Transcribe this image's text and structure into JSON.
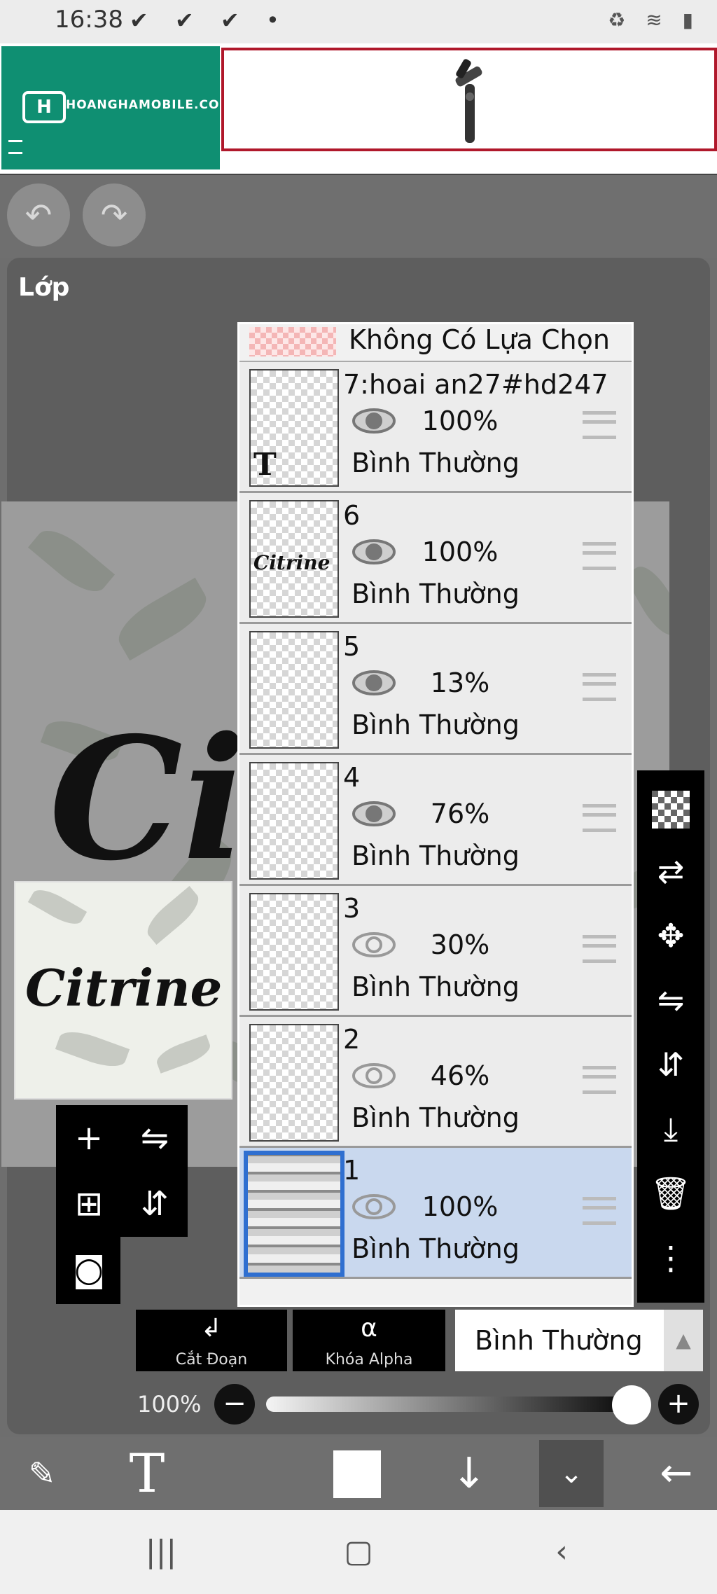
{
  "status_bar": {
    "time": "16:38",
    "notifications": "✔ ✔ ✔ •",
    "system_icons": "♻ ≋ ▮"
  },
  "ad": {
    "brand": "HOANGHAMOBILE.COM",
    "logo_glyph": "H",
    "image_icon": "gimbal-image"
  },
  "panel": {
    "title": "Lớp"
  },
  "canvas": {
    "thumbnail_word": "Citrine",
    "preview_text": "Cit"
  },
  "layers_header": {
    "label": "Không Có Lựa Chọn"
  },
  "layers": [
    {
      "name": "7:hoai an27#hd247",
      "opacity": "100%",
      "mode": "Bình Thường",
      "visible": true,
      "thumb_glyph": "T",
      "selected": false
    },
    {
      "name": "6",
      "opacity": "100%",
      "mode": "Bình Thường",
      "visible": true,
      "thumb_glyph": "Citrine",
      "selected": false
    },
    {
      "name": "5",
      "opacity": "13%",
      "mode": "Bình Thường",
      "visible": true,
      "thumb_glyph": "",
      "selected": false
    },
    {
      "name": "4",
      "opacity": "76%",
      "mode": "Bình Thường",
      "visible": true,
      "thumb_glyph": "",
      "selected": false
    },
    {
      "name": "3",
      "opacity": "30%",
      "mode": "Bình Thường",
      "visible": false,
      "thumb_glyph": "",
      "selected": false
    },
    {
      "name": "2",
      "opacity": "46%",
      "mode": "Bình Thường",
      "visible": false,
      "thumb_glyph": "",
      "selected": false
    },
    {
      "name": "1",
      "opacity": "100%",
      "mode": "Bình Thường",
      "visible": false,
      "thumb_glyph": "",
      "selected": true
    }
  ],
  "blend": {
    "clip_label": "Cắt Đoạn",
    "alpha_label": "Khóa Alpha",
    "mode": "Bình Thường"
  },
  "opacity_slider": {
    "label": "100%",
    "value": 1.0
  },
  "icons": {
    "undo": "undo-icon",
    "redo": "redo-icon"
  },
  "colors": {
    "accent_selected": "#2f6fd0",
    "selected_row": "#c9d8ee",
    "ad_green": "#0f8f72",
    "ad_border": "#b0182b"
  }
}
